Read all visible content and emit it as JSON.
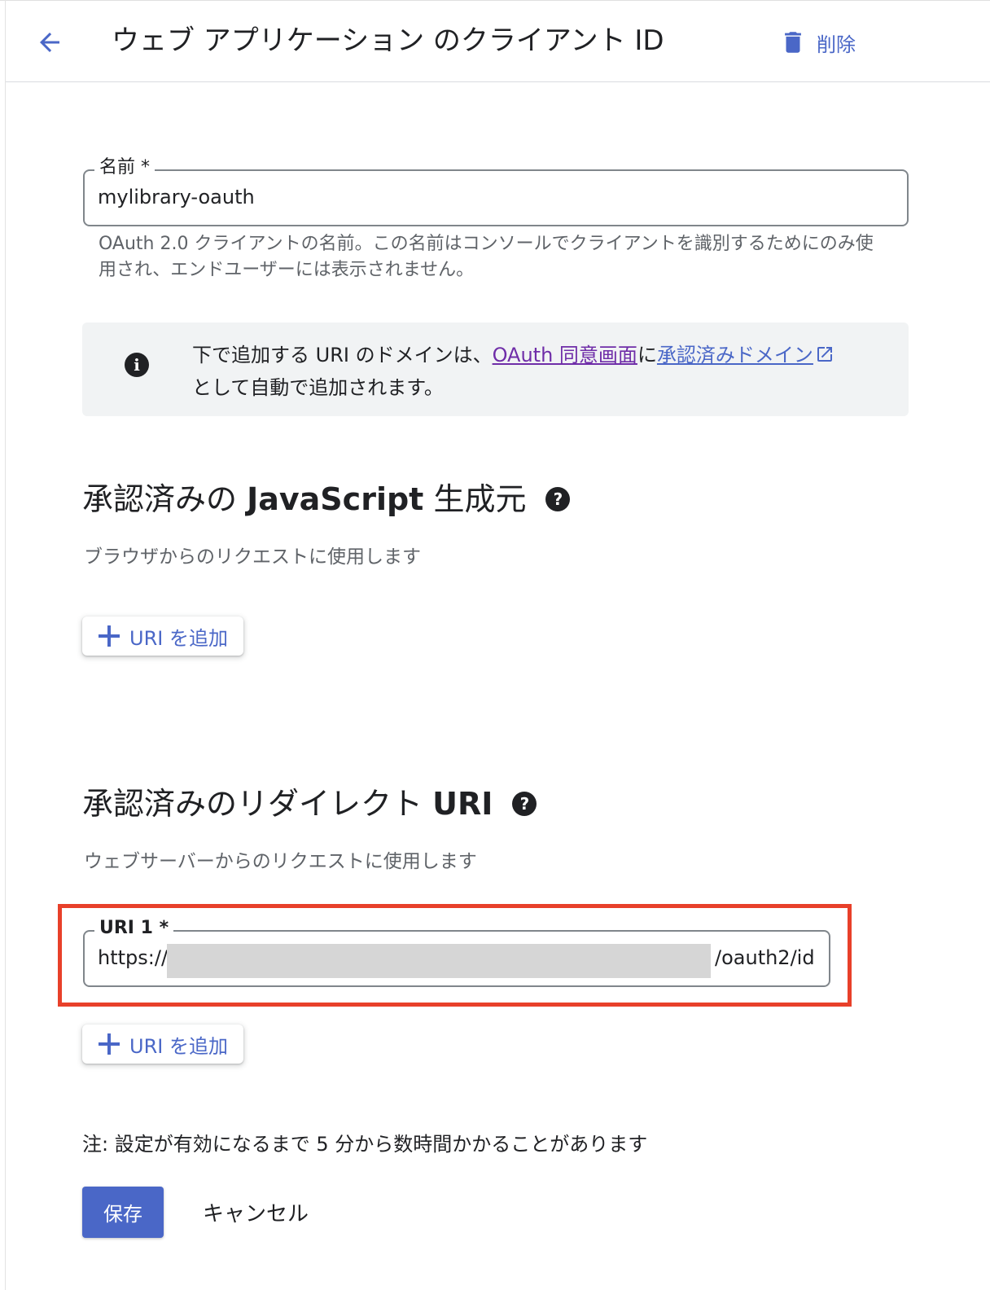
{
  "header": {
    "title": "ウェブ アプリケーション のクライアント ID",
    "delete_label": "削除",
    "back_icon": "arrow-left-icon",
    "delete_icon": "trash-icon"
  },
  "name_field": {
    "label": "名前 *",
    "value": "mylibrary-oauth",
    "helper": "OAuth 2.0 クライアントの名前。この名前はコンソールでクライアントを識別するためにのみ使用され、エンドユーザーには表示されません。"
  },
  "info": {
    "icon": "info-icon",
    "text_before": "下で追加する URI のドメインは、",
    "link1": "OAuth 同意画面",
    "text_mid": "に",
    "link2": "承認済みドメイン",
    "text_after": "として自動で追加されます。",
    "external_icon": "open-in-new-icon"
  },
  "js_origins": {
    "title_prefix": "承認済みの",
    "title_bold": "JavaScript",
    "title_suffix": "生成元",
    "subtitle": "ブラウザからのリクエストに使用します",
    "add_label": "URI を追加"
  },
  "redirect_uris": {
    "title_prefix": "承認済みのリダイレクト",
    "title_bold": "URI",
    "subtitle": "ウェブサーバーからのリクエストに使用します",
    "uri1_label": "URI 1 *",
    "uri1_value_start": "https://",
    "uri1_value_end": "/oauth2/id",
    "add_label": "URI を追加"
  },
  "footer": {
    "note": "注: 設定が有効になるまで 5 分から数時間かかることがあります",
    "save_label": "保存",
    "cancel_label": "キャンセル"
  },
  "colors": {
    "accent": "#4a67c7",
    "link_visited": "#6f2da8",
    "highlight": "#e8402a",
    "info_bg": "#f1f3f4"
  }
}
